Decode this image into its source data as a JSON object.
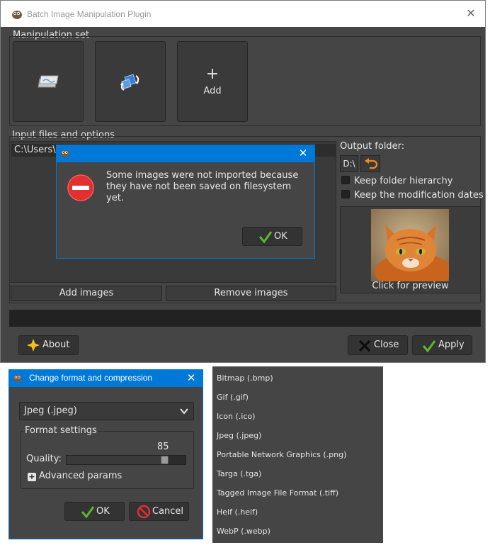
{
  "main_window": {
    "title": "Batch Image Manipulation Plugin",
    "manipulation_set_label": "Manipulation set",
    "manipulations": [
      {
        "icon": "resize-icon",
        "label": ""
      },
      {
        "icon": "change-format-icon",
        "label": ""
      },
      {
        "icon": "add-icon",
        "label": "Add"
      }
    ],
    "input_files_label": "Input files and options",
    "files": [
      "C:\\Users\\"
    ],
    "add_images_label": "Add images",
    "remove_images_label": "Remove images",
    "output_folder_label": "Output folder:",
    "output_drive": "D:\\",
    "keep_folder_hierarchy_label": "Keep folder hierarchy",
    "keep_modification_dates_label": "Keep the modification dates",
    "preview_label": "Click for preview",
    "about_label": "About",
    "close_label": "Close",
    "apply_label": "Apply"
  },
  "error_dialog": {
    "message": "Some images were not imported because they have not been saved on filesystem yet.",
    "ok_label": "OK"
  },
  "format_dialog": {
    "title": "Change format and compression",
    "selected_format": "Jpeg (.jpeg)",
    "format_settings_label": "Format settings",
    "quality_label": "Quality:",
    "quality_value": "85",
    "quality_fraction": 0.85,
    "advanced_label": "Advanced params",
    "ok_label": "OK",
    "cancel_label": "Cancel"
  },
  "format_options": [
    "Bitmap (.bmp)",
    "Gif (.gif)",
    "Icon (.ico)",
    "Jpeg (.jpeg)",
    "Portable Network Graphics (.png)",
    "Targa (.tga)",
    "Tagged Image File Format (.tiff)",
    "Heif (.heif)",
    "WebP (.webp)"
  ],
  "colors": {
    "accent_blue": "#0078d7",
    "panel": "#454545",
    "check_green": "#5cb82e",
    "error_red": "#e03030",
    "star_yellow": "#f2c21b"
  }
}
